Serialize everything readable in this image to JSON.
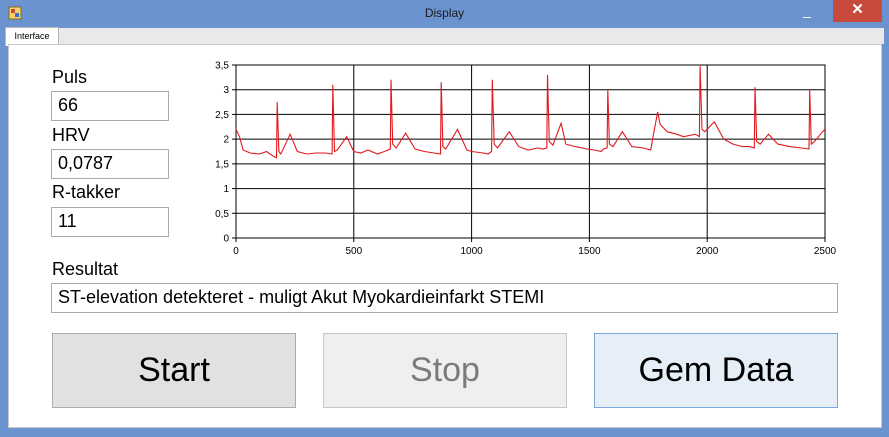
{
  "window": {
    "title": "Display",
    "controls": {
      "minimize": "_",
      "maximize": "□",
      "close": "✕"
    }
  },
  "tabs": [
    "Interface"
  ],
  "fields": {
    "puls_label": "Puls",
    "puls_value": "66",
    "hrv_label": "HRV",
    "hrv_value": "0,0787",
    "rtakker_label": "R-takker",
    "rtakker_value": "11",
    "resultat_label": "Resultat",
    "resultat_value": "ST-elevation detekteret - muligt Akut Myokardieinfarkt STEMI"
  },
  "buttons": {
    "start": "Start",
    "stop": "Stop",
    "gem": "Gem Data"
  },
  "colors": {
    "signal": "#e0191f",
    "close": "#c84a3d"
  },
  "chart_data": {
    "type": "line",
    "title": "",
    "xlabel": "",
    "ylabel": "",
    "xlim": [
      0,
      2500
    ],
    "ylim": [
      0,
      3.5
    ],
    "x_ticks": [
      "0",
      "500",
      "1000",
      "1500",
      "2000",
      "2500"
    ],
    "y_ticks": [
      "0",
      "0,5",
      "1",
      "1,5",
      "2",
      "2,5",
      "3",
      "3,5"
    ],
    "grid": true,
    "series": [
      {
        "x": [
          0,
          15,
          30,
          60,
          100,
          130,
          160,
          172,
          175,
          182,
          190,
          230,
          260,
          300,
          340,
          380,
          408,
          411,
          418,
          430,
          470,
          500,
          530,
          560,
          600,
          630,
          655,
          658,
          665,
          680,
          720,
          760,
          800,
          840,
          868,
          871,
          878,
          890,
          940,
          980,
          1000,
          1050,
          1070,
          1085,
          1088,
          1096,
          1110,
          1160,
          1200,
          1240,
          1280,
          1303,
          1319,
          1322,
          1330,
          1345,
          1380,
          1400,
          1440,
          1490,
          1520,
          1550,
          1560,
          1575,
          1578,
          1585,
          1600,
          1640,
          1680,
          1730,
          1760,
          1776,
          1790,
          1800,
          1830,
          1870,
          1900,
          1950,
          1967,
          1970,
          1978,
          1990,
          2030,
          2070,
          2110,
          2150,
          2180,
          2200,
          2203,
          2210,
          2225,
          2260,
          2300,
          2350,
          2400,
          2432,
          2435,
          2442,
          2455,
          2490,
          2500
        ],
        "y": [
          2.2,
          2.05,
          1.78,
          1.72,
          1.7,
          1.75,
          1.65,
          1.62,
          2.75,
          1.75,
          1.7,
          2.1,
          1.75,
          1.7,
          1.72,
          1.72,
          1.7,
          3.1,
          1.75,
          1.78,
          2.05,
          1.75,
          1.72,
          1.78,
          1.7,
          1.75,
          1.8,
          3.2,
          1.9,
          1.82,
          2.12,
          1.8,
          1.75,
          1.72,
          1.7,
          3.15,
          1.85,
          1.8,
          2.2,
          1.78,
          1.75,
          1.72,
          1.7,
          1.75,
          3.2,
          1.9,
          1.82,
          2.15,
          1.85,
          1.78,
          1.82,
          1.8,
          1.82,
          3.3,
          1.95,
          1.88,
          2.32,
          1.9,
          1.85,
          1.8,
          1.78,
          1.75,
          1.8,
          1.82,
          3.0,
          1.9,
          1.85,
          2.15,
          1.85,
          1.82,
          1.78,
          2.2,
          2.55,
          2.3,
          2.15,
          2.1,
          2.05,
          2.1,
          2.05,
          3.48,
          2.2,
          2.15,
          2.35,
          2.0,
          1.9,
          1.85,
          1.85,
          1.82,
          3.05,
          1.95,
          1.9,
          2.1,
          1.9,
          1.85,
          1.82,
          1.8,
          3.0,
          1.9,
          1.95,
          2.15,
          2.2
        ]
      }
    ]
  }
}
